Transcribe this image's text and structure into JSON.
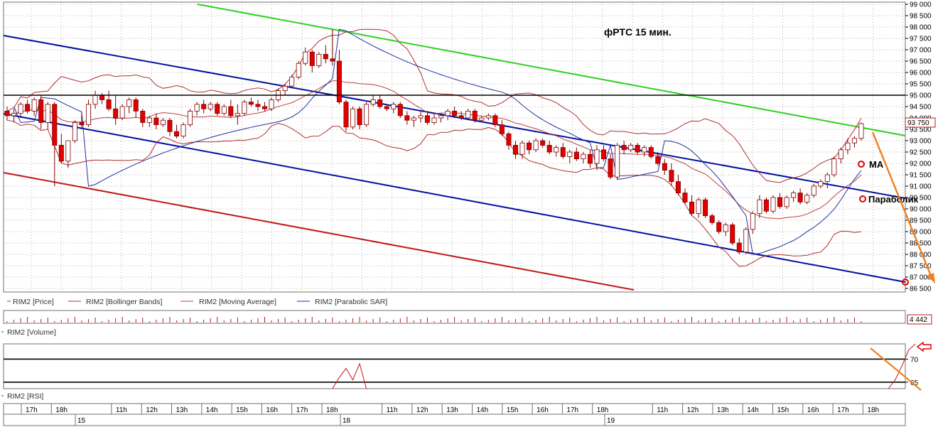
{
  "title": "фРТС   15 мин.",
  "annotations": {
    "ma": "МА",
    "parabolic": "Параболик"
  },
  "legend_price": [
    "RIM2 [Price]",
    "RIM2 [Bollinger Bands]",
    "RIM2 [Moving Average]",
    "RIM2 [Parabolic SAR]"
  ],
  "legend_volume": "RIM2 [Volume]",
  "legend_rsi": "RIM2 [RSI]",
  "colors": {
    "bear": "#e00000",
    "bull": "#ffffff",
    "bollinger": "#b03030",
    "ma": "#c04040",
    "sar": "#2030a0",
    "channel": "#0010a0",
    "resistance": "#30d020",
    "support_red": "#c01818",
    "arrow": "#f08020",
    "hline": "#000000"
  },
  "chart_data": [
    {
      "type": "candlestick",
      "name": "price",
      "ylim": [
        86500,
        99000
      ],
      "y_ticks": [
        "99 000",
        "98 500",
        "98 000",
        "97 500",
        "97 000",
        "96 500",
        "96 000",
        "95 500",
        "95 000",
        "94 500",
        "94 000",
        "93 500",
        "93 000",
        "92 500",
        "92 000",
        "91 500",
        "91 000",
        "90 500",
        "90 000",
        "89 500",
        "89 000",
        "88 500",
        "88 000",
        "87 500",
        "87 000",
        "86 500"
      ],
      "last_price_label": "93 750",
      "hlines": [
        95000
      ],
      "candles": [
        [
          94300,
          94500,
          93900,
          94100
        ],
        [
          94100,
          94400,
          93800,
          94200
        ],
        [
          94200,
          94700,
          94000,
          94600
        ],
        [
          94600,
          94800,
          94200,
          94300
        ],
        [
          94300,
          94900,
          94100,
          94800
        ],
        [
          94800,
          95000,
          93500,
          93800
        ],
        [
          93800,
          94700,
          93500,
          94600
        ],
        [
          94600,
          94700,
          91000,
          92800
        ],
        [
          92800,
          93300,
          92000,
          92100
        ],
        [
          92100,
          93000,
          91800,
          93000
        ],
        [
          93000,
          93900,
          92900,
          93800
        ],
        [
          93800,
          94200,
          93500,
          93700
        ],
        [
          93700,
          94800,
          93600,
          94600
        ],
        [
          94600,
          95200,
          94400,
          95000
        ],
        [
          95000,
          95100,
          94600,
          94800
        ],
        [
          94800,
          95200,
          94300,
          94400
        ],
        [
          94400,
          95000,
          93700,
          94000
        ],
        [
          94000,
          94600,
          93900,
          94500
        ],
        [
          94500,
          94900,
          94200,
          94800
        ],
        [
          94800,
          94900,
          94000,
          94300
        ],
        [
          94300,
          94400,
          93600,
          93800
        ],
        [
          93800,
          94100,
          93600,
          94000
        ],
        [
          94000,
          94200,
          93500,
          93700
        ],
        [
          93700,
          94000,
          93600,
          93900
        ],
        [
          93900,
          94000,
          93200,
          93400
        ],
        [
          93400,
          93700,
          93100,
          93200
        ],
        [
          93200,
          93800,
          93100,
          93700
        ],
        [
          93700,
          94400,
          93600,
          94300
        ],
        [
          94300,
          94700,
          94100,
          94600
        ],
        [
          94600,
          94800,
          94200,
          94400
        ],
        [
          94400,
          94700,
          94300,
          94600
        ],
        [
          94600,
          94700,
          94100,
          94200
        ],
        [
          94200,
          94600,
          94100,
          94500
        ],
        [
          94500,
          94800,
          94000,
          94100
        ],
        [
          94100,
          94600,
          93700,
          94200
        ],
        [
          94200,
          94800,
          94100,
          94700
        ],
        [
          94700,
          94900,
          94500,
          94600
        ],
        [
          94600,
          94800,
          94300,
          94500
        ],
        [
          94500,
          94700,
          94300,
          94400
        ],
        [
          94400,
          94900,
          94300,
          94800
        ],
        [
          94800,
          95300,
          94700,
          95200
        ],
        [
          95200,
          95500,
          95000,
          95400
        ],
        [
          95400,
          95900,
          95300,
          95800
        ],
        [
          95800,
          96500,
          95700,
          96400
        ],
        [
          96400,
          97100,
          96300,
          96900
        ],
        [
          96900,
          97000,
          96000,
          96300
        ],
        [
          96300,
          96900,
          96200,
          96800
        ],
        [
          96800,
          97200,
          96400,
          96600
        ],
        [
          96600,
          97900,
          96300,
          96500
        ],
        [
          96500,
          97000,
          94600,
          94700
        ],
        [
          94700,
          94800,
          93400,
          93600
        ],
        [
          93600,
          94500,
          93500,
          94400
        ],
        [
          94400,
          94500,
          93500,
          93700
        ],
        [
          93700,
          94700,
          93600,
          94600
        ],
        [
          94600,
          95000,
          94500,
          94800
        ],
        [
          94800,
          95000,
          94400,
          94500
        ],
        [
          94500,
          94600,
          94300,
          94400
        ],
        [
          94400,
          94700,
          94200,
          94600
        ],
        [
          94600,
          94700,
          94000,
          94100
        ],
        [
          94100,
          94300,
          93700,
          93900
        ],
        [
          93900,
          94100,
          93600,
          94000
        ],
        [
          94000,
          94300,
          93800,
          94100
        ],
        [
          94100,
          94300,
          93700,
          93800
        ],
        [
          93800,
          94200,
          93700,
          94000
        ],
        [
          94000,
          94200,
          93800,
          94100
        ],
        [
          94100,
          94400,
          93900,
          94300
        ],
        [
          94300,
          94500,
          94000,
          94100
        ],
        [
          94100,
          94300,
          93900,
          94000
        ],
        [
          94000,
          94400,
          93900,
          94300
        ],
        [
          94300,
          94400,
          93800,
          93900
        ],
        [
          93900,
          94100,
          93800,
          94000
        ],
        [
          94000,
          94200,
          93900,
          94100
        ],
        [
          94100,
          94200,
          93600,
          93700
        ],
        [
          93700,
          93900,
          93200,
          93300
        ],
        [
          93300,
          93400,
          92600,
          92800
        ],
        [
          92800,
          93000,
          92200,
          92400
        ],
        [
          92400,
          93000,
          92200,
          92900
        ],
        [
          92900,
          93000,
          92400,
          92600
        ],
        [
          92600,
          93100,
          92500,
          93000
        ],
        [
          93000,
          93100,
          92700,
          92800
        ],
        [
          92800,
          93000,
          92400,
          92500
        ],
        [
          92500,
          92800,
          92300,
          92700
        ],
        [
          92700,
          92900,
          92200,
          92300
        ],
        [
          92300,
          92600,
          92000,
          92500
        ],
        [
          92500,
          92700,
          92100,
          92200
        ],
        [
          92200,
          92500,
          92000,
          92400
        ],
        [
          92400,
          92600,
          91800,
          92000
        ],
        [
          92000,
          92800,
          91700,
          92600
        ],
        [
          92600,
          92800,
          92100,
          92200
        ],
        [
          92200,
          92400,
          91300,
          91400
        ],
        [
          91400,
          92900,
          91300,
          92800
        ],
        [
          92800,
          93000,
          92400,
          92600
        ],
        [
          92600,
          92900,
          92500,
          92800
        ],
        [
          92800,
          92900,
          92400,
          92500
        ],
        [
          92500,
          92800,
          92300,
          92700
        ],
        [
          92700,
          92800,
          92200,
          92300
        ],
        [
          92300,
          92500,
          91900,
          92000
        ],
        [
          92000,
          92200,
          91500,
          91700
        ],
        [
          91700,
          92000,
          91000,
          91200
        ],
        [
          91200,
          91500,
          90600,
          90700
        ],
        [
          90700,
          90900,
          90200,
          90300
        ],
        [
          90300,
          90600,
          89700,
          89800
        ],
        [
          89800,
          90500,
          89600,
          90400
        ],
        [
          90400,
          90500,
          89600,
          89700
        ],
        [
          89700,
          89800,
          89300,
          89400
        ],
        [
          89400,
          89500,
          88900,
          89000
        ],
        [
          89000,
          89400,
          88800,
          89300
        ],
        [
          89300,
          89400,
          88400,
          88500
        ],
        [
          88500,
          88700,
          88000,
          88100
        ],
        [
          88100,
          89200,
          88000,
          89100
        ],
        [
          89100,
          89900,
          88900,
          89800
        ],
        [
          89800,
          90600,
          89600,
          90400
        ],
        [
          90400,
          90500,
          89800,
          89900
        ],
        [
          89900,
          90600,
          89800,
          90500
        ],
        [
          90500,
          90700,
          90000,
          90100
        ],
        [
          90100,
          90600,
          90000,
          90500
        ],
        [
          90500,
          90800,
          90300,
          90700
        ],
        [
          90700,
          90900,
          90200,
          90300
        ],
        [
          90300,
          90700,
          90200,
          90600
        ],
        [
          90600,
          91100,
          90500,
          91000
        ],
        [
          91000,
          91300,
          90900,
          91200
        ],
        [
          91200,
          91600,
          90900,
          91500
        ],
        [
          91500,
          92300,
          91400,
          92200
        ],
        [
          92200,
          92700,
          92000,
          92600
        ],
        [
          92600,
          93100,
          92400,
          92900
        ],
        [
          92900,
          93200,
          92700,
          93100
        ],
        [
          93100,
          93800,
          93000,
          93750
        ]
      ]
    },
    {
      "type": "line",
      "name": "RSI",
      "ylim": [
        63.6,
        73.3
      ],
      "y_ticks": [
        "70",
        "65"
      ],
      "hlines": [
        70,
        65
      ],
      "segments": [
        {
          "start_index": 48,
          "values": [
            63.5,
            66.0,
            68.0,
            65.5,
            69.0,
            63.5
          ]
        },
        {
          "start_index": 130,
          "values": [
            63.5,
            65.5,
            68.5,
            72.0,
            73.3
          ]
        }
      ]
    },
    {
      "type": "bar",
      "name": "Volume",
      "last_value_label": "4 442"
    }
  ],
  "time_axis": {
    "hour_labels": [
      "17h",
      "18h",
      "11h",
      "12h",
      "13h",
      "14h",
      "15h",
      "16h",
      "17h",
      "18h",
      "11h",
      "12h",
      "13h",
      "14h",
      "15h",
      "16h",
      "17h",
      "18h",
      "11h",
      "12h",
      "13h",
      "14h",
      "15h",
      "16h",
      "17h",
      "18h"
    ],
    "day_labels": [
      "15",
      "18",
      "19"
    ]
  }
}
